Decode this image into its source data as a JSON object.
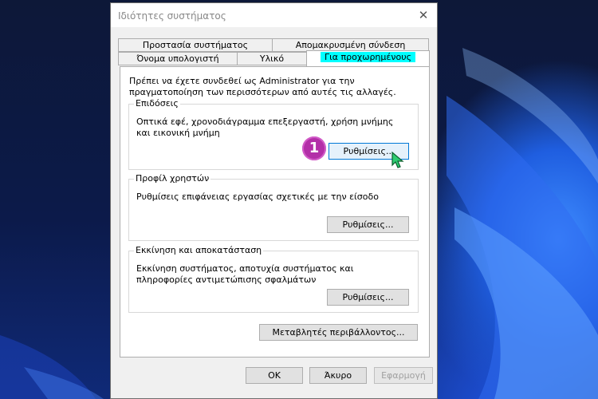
{
  "window": {
    "title": "Ιδιότητες συστήματος",
    "close_glyph": "✕"
  },
  "tabs": {
    "row1": [
      {
        "label": "Προστασία συστήματος"
      },
      {
        "label": "Απομακρυσμένη σύνδεση"
      }
    ],
    "row2": [
      {
        "label": "Όνομα υπολογιστή"
      },
      {
        "label": "Υλικό"
      },
      {
        "label": "Για προχωρημένους",
        "active": true,
        "highlight": "#00ffff"
      }
    ]
  },
  "panel": {
    "intro": "Πρέπει να έχετε συνδεθεί ως Administrator για την πραγματοποίηση των περισσότερων από αυτές τις αλλαγές.",
    "performance": {
      "title": "Επιδόσεις",
      "description": "Οπτικά εφέ, χρονοδιάγραμμα επεξεργαστή, χρήση μνήμης και εικονική μνήμη",
      "button": "Ρυθμίσεις..."
    },
    "user_profiles": {
      "title": "Προφίλ χρηστών",
      "description": "Ρυθμίσεις επιφάνειας εργασίας σχετικές με την είσοδο",
      "button": "Ρυθμίσεις..."
    },
    "startup_recovery": {
      "title": "Εκκίνηση και αποκατάσταση",
      "description": "Εκκίνηση συστήματος, αποτυχία συστήματος και πληροφορίες αντιμετώπισης σφαλμάτων",
      "button": "Ρυθμίσεις..."
    },
    "env_button": "Μεταβλητές περιβάλλοντος..."
  },
  "footer": {
    "ok": "OK",
    "cancel": "Άκυρο",
    "apply": "Εφαρμογή"
  },
  "annotation": {
    "step_number": "1",
    "badge_color": "#b32fa8",
    "cursor_color": "#2ecc71",
    "cursor_icon": "arrow-cursor-icon"
  }
}
